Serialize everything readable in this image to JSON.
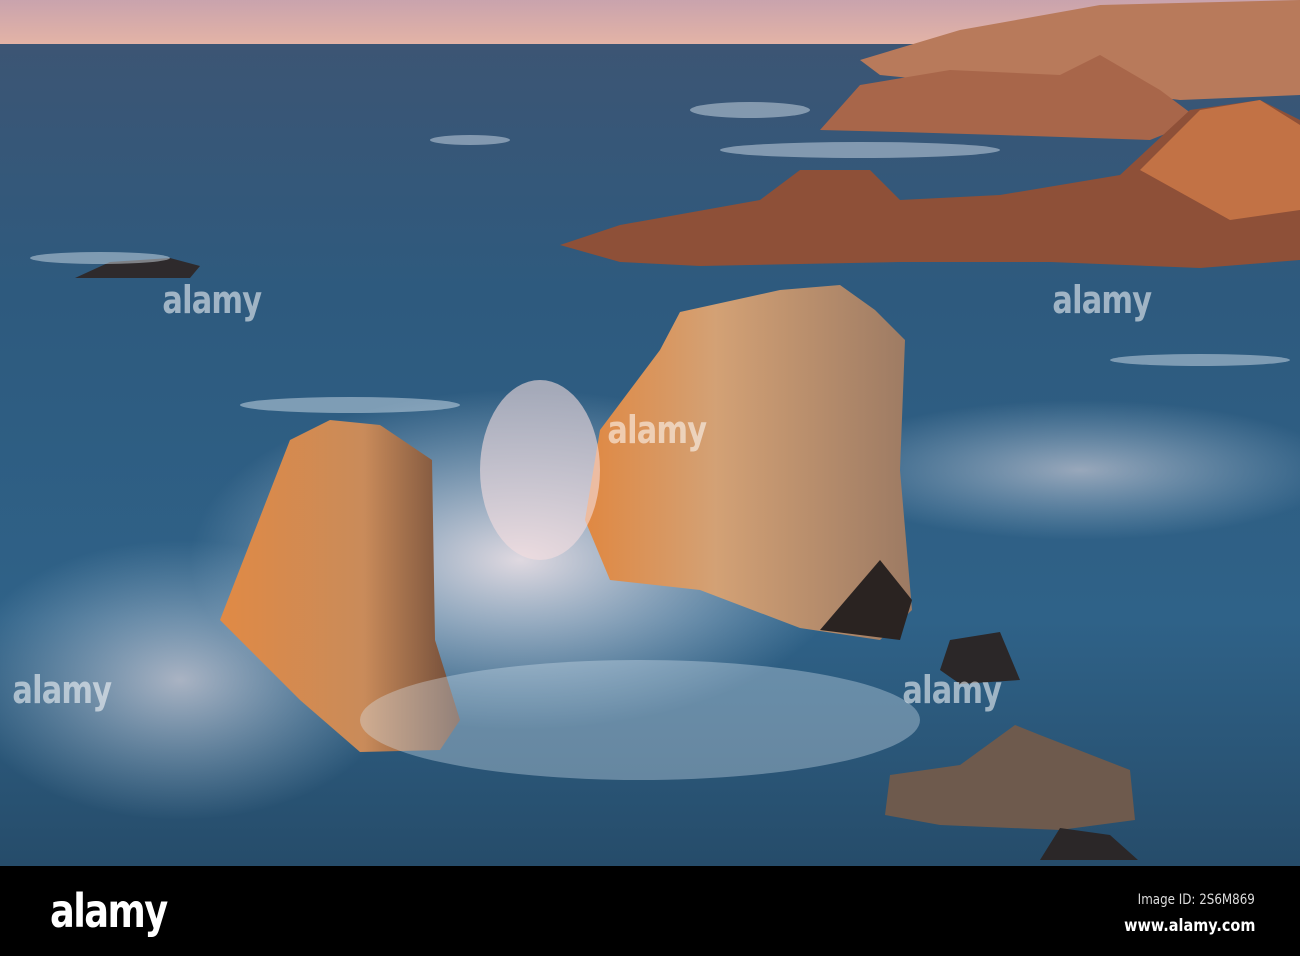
{
  "photo": {
    "subject": "sea-stacks-coast",
    "colors": {
      "sky": "#d9a9a8",
      "sea": "#2c5a7d",
      "rock_lit": "#d88a4c",
      "rock_shadow": "#3a2a26",
      "surf": "#dfeaf5"
    }
  },
  "watermark": {
    "logo": "alamy"
  },
  "footer": {
    "logo": "alamy",
    "image_id": "Image ID: 2S6M869",
    "website": "www.alamy.com"
  }
}
